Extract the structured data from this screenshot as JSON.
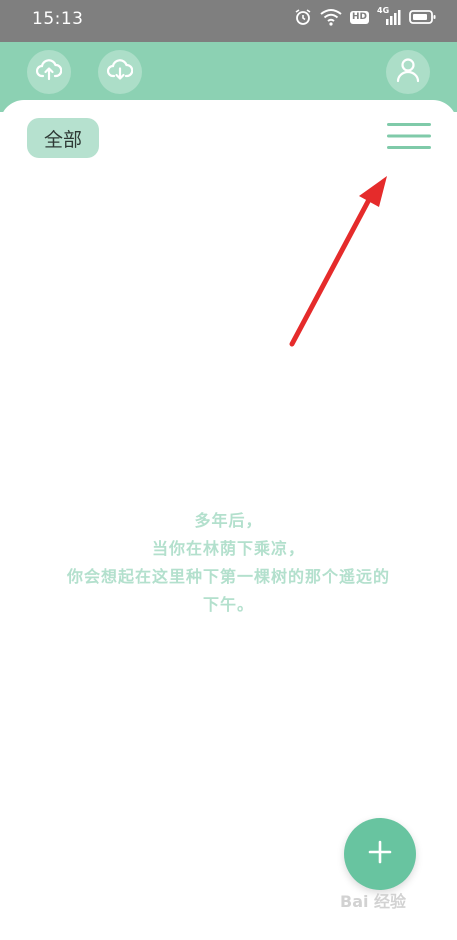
{
  "status_bar": {
    "time": "15:13",
    "hd": "HD",
    "network": "4G",
    "icons": [
      "alarm-icon",
      "wifi-icon",
      "signal-icon",
      "battery-icon"
    ]
  },
  "header": {
    "buttons": [
      "cloud-upload-icon",
      "cloud-download-icon",
      "user-icon"
    ]
  },
  "filter": {
    "label": "全部"
  },
  "quote": {
    "lines": [
      "多年后，",
      "当你在林荫下乘凉，",
      "你会想起在这里种下第一棵树的那个遥远的",
      "下午。"
    ]
  },
  "fab": {
    "icon": "plus-icon"
  },
  "watermark": {
    "text": "Bai 经验"
  },
  "colors": {
    "header": "#8cd1b3",
    "chip": "#b6e1cf",
    "accent": "#68c4a0",
    "quote": "#b3e0cd",
    "status_bar": "#7f7f7f",
    "annotation_arrow": "#e52b2b"
  }
}
